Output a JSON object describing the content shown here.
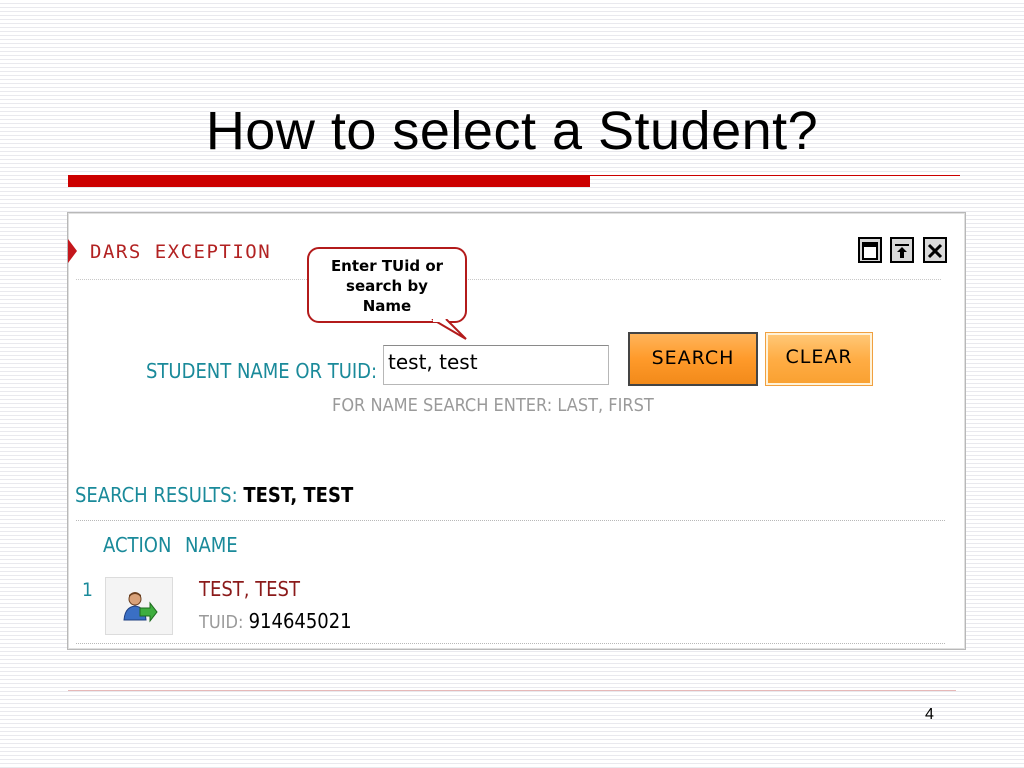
{
  "slide": {
    "title": "How to select a Student?",
    "page_number": "4"
  },
  "panel": {
    "title": "DARS EXCEPTION",
    "window_buttons": [
      "restore-icon",
      "pin-icon",
      "close-icon"
    ],
    "callout": "Enter TUid or\nsearch by\nName",
    "search": {
      "label": "STUDENT NAME OR TUID:",
      "value": "test, test",
      "hint": "FOR NAME SEARCH ENTER: LAST, FIRST",
      "search_label": "SEARCH",
      "clear_label": "CLEAR"
    },
    "results": {
      "label": "SEARCH RESULTS:",
      "query": "TEST, TEST",
      "columns": [
        "ACTION",
        "NAME"
      ],
      "rows": [
        {
          "index": "1",
          "name": "TEST, TEST",
          "tuid_label": "TUID:",
          "tuid": "914645021"
        }
      ]
    }
  },
  "colors": {
    "accent_red": "#cc0000",
    "teal_label": "#1a8a9a",
    "button_orange": "#ff9a2a"
  }
}
